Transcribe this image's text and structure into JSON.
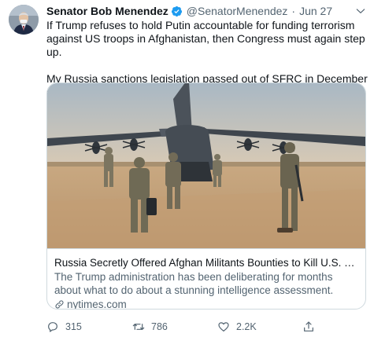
{
  "tweet": {
    "author_name": "Senator Bob Menendez",
    "handle": "@SenatorMenendez",
    "separator": "·",
    "date": "Jun 27",
    "paragraphs": [
      "If Trump refuses to hold Putin accountable for funding terrorism against US troops in Afghanistan, then Congress must again step up.",
      "My Russia sanctions legislation passed out of SFRC in December and is waiting for a vote. McConnell must act this week."
    ]
  },
  "card": {
    "title": "Russia Secretly Offered Afghan Militants Bounties to Kill U.S. Troop...",
    "description": "The Trump administration has been deliberating for months about what to do about a stunning intelligence assessment.",
    "domain": "nytimes.com"
  },
  "actions": {
    "reply_count": "315",
    "retweet_count": "786",
    "like_count": "2.2K"
  },
  "icons": {
    "verified": "verified-badge-icon",
    "more": "chevron-down-icon",
    "link": "link-icon",
    "reply": "reply-icon",
    "retweet": "retweet-icon",
    "like": "heart-icon",
    "share": "share-icon"
  },
  "colors": {
    "text_primary": "#0f1419",
    "text_secondary": "#536471",
    "verified_blue": "#1d9bf0",
    "border": "#cfd9de"
  }
}
